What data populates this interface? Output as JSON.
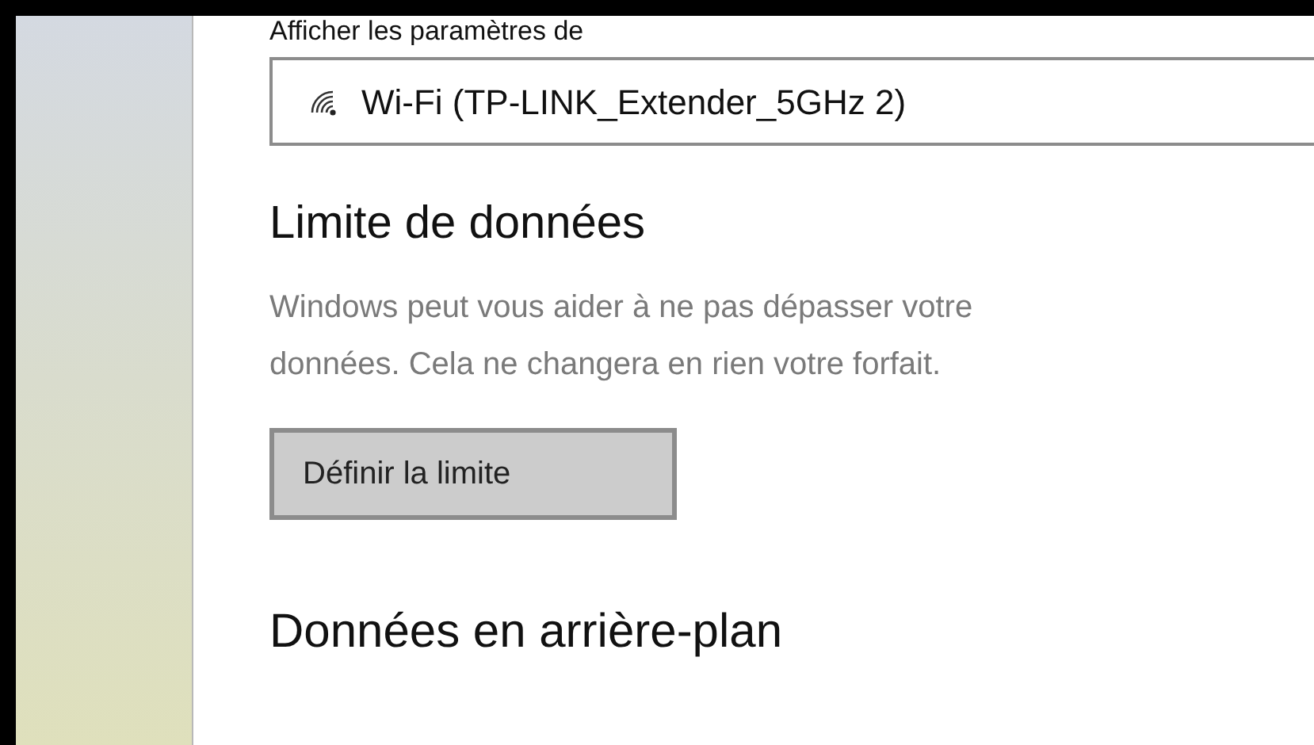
{
  "settings_label": "Afficher les paramètres de",
  "network_dropdown": {
    "value": "Wi-Fi (TP-LINK_Extender_5GHz 2)"
  },
  "data_limit": {
    "heading": "Limite de données",
    "description": "Windows peut vous aider à ne pas dépasser votre\ndonnées. Cela ne changera en rien votre forfait.",
    "button": "Définir la limite"
  },
  "background_data": {
    "heading": "Données en arrière-plan"
  }
}
